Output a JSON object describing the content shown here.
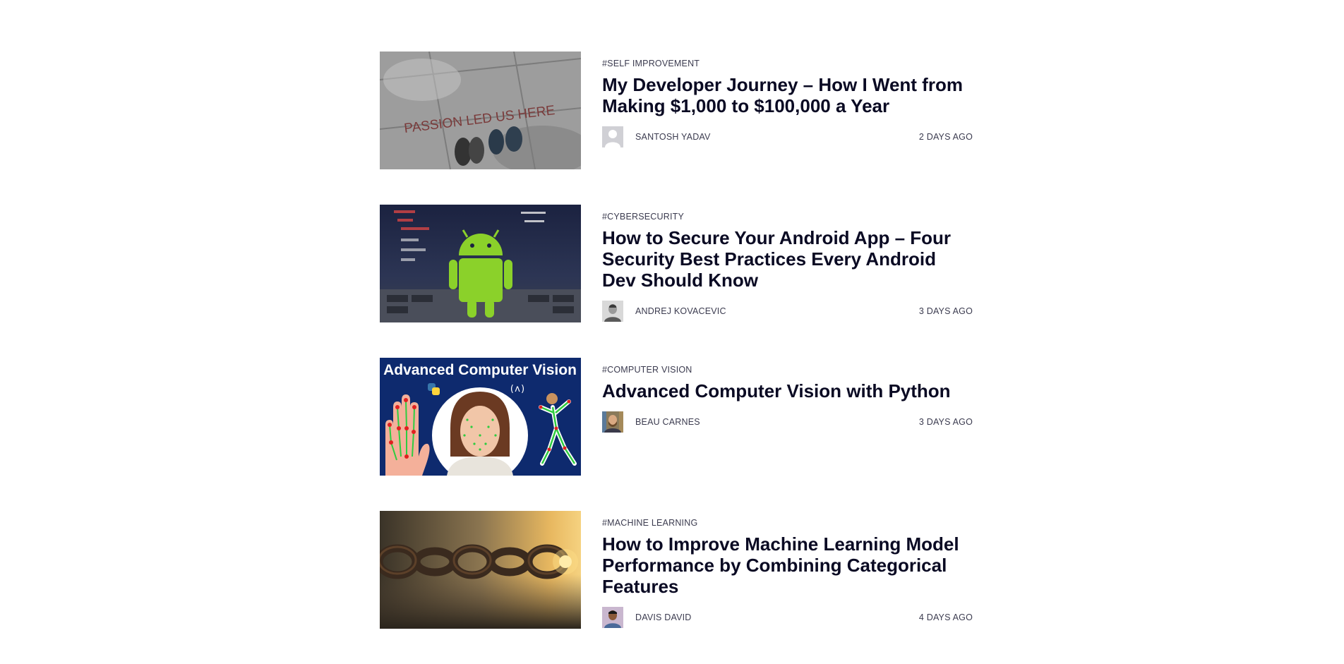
{
  "posts": [
    {
      "tag": "#SELF IMPROVEMENT",
      "title": "My Developer Journey – How I Went from Making $1,000 to $100,000 a Year",
      "author": "SANTOSH YADAV",
      "time": "2 DAYS AGO",
      "image_text": "PASSION LED US HERE"
    },
    {
      "tag": "#CYBERSECURITY",
      "title": "How to Secure Your Android App – Four Security Best Practices Every Android Dev Should Know",
      "author": "ANDREJ KOVACEVIC",
      "time": "3 DAYS AGO"
    },
    {
      "tag": "#COMPUTER VISION",
      "title": "Advanced Computer Vision with Python",
      "author": "BEAU CARNES",
      "time": "3 DAYS AGO",
      "image_text": "Advanced Computer Vision",
      "image_logo": "(ʌ)"
    },
    {
      "tag": "#MACHINE LEARNING",
      "title": "How to Improve Machine Learning Model Performance by Combining Categorical Features",
      "author": "DAVIS DAVID",
      "time": "4 DAYS AGO"
    }
  ],
  "colors": {
    "text": "#0a0a23",
    "meta": "#3b3b4f",
    "android_green": "#8bd12a",
    "cv_background": "#0e2a6e"
  }
}
